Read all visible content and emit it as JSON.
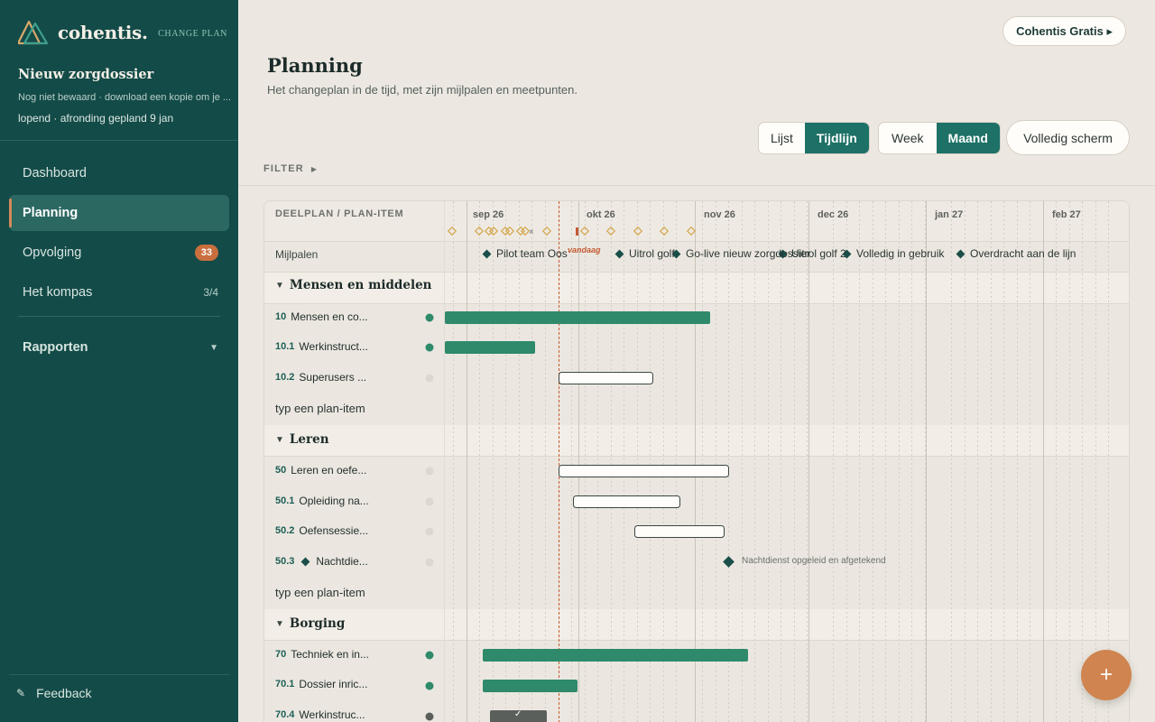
{
  "brand": {
    "name": "cohentis.",
    "tag": "CHANGE PLAN"
  },
  "dossier": {
    "title": "Nieuw zorgdossier",
    "note": "Nog niet bewaard · download een kopie om je ...",
    "status": "lopend · afronding gepland 9 jan"
  },
  "nav": {
    "dashboard": "Dashboard",
    "planning": "Planning",
    "opvolging": "Opvolging",
    "opvolging_badge": "33",
    "kompas": "Het kompas",
    "kompas_count": "3/4",
    "rapporten": "Rapporten"
  },
  "feedback": "Feedback",
  "header": {
    "plan_button": "Cohentis Gratis ▸",
    "title": "Planning",
    "subtitle": "Het changeplan in de tijd, met zijn mijlpalen en meetpunten."
  },
  "view_toggle": {
    "list": "Lijst",
    "timeline": "Tijdlijn"
  },
  "scale_toggle": {
    "week": "Week",
    "month": "Maand"
  },
  "fullscreen": "Volledig scherm",
  "filter": "FILTER",
  "timeline": {
    "column_header": "DEELPLAN / PLAN-ITEM",
    "months": [
      "sep 26",
      "okt 26",
      "nov 26",
      "dec 26",
      "jan 27",
      "feb 27"
    ],
    "today_label": "vandaag",
    "milestones_row_label": "Mijlpalen",
    "milestones": [
      "Pilot team Oos",
      "Uitrol golf",
      "Go-live nieuw zorgdossier",
      "Uitrol golf 2",
      "Volledig in gebruik",
      "Overdracht aan de lijn"
    ],
    "add_item": "typ een plan-item",
    "groups": [
      {
        "name": "Mensen en middelen",
        "items": [
          {
            "num": "10",
            "label": "Mensen en co...",
            "status": "active"
          },
          {
            "num": "10.1",
            "label": "Werkinstruct...",
            "status": "active"
          },
          {
            "num": "10.2",
            "label": "Superusers ...",
            "status": "planned"
          }
        ]
      },
      {
        "name": "Leren",
        "items": [
          {
            "num": "50",
            "label": "Leren en oefe...",
            "status": "planned"
          },
          {
            "num": "50.1",
            "label": "Opleiding na...",
            "status": "planned"
          },
          {
            "num": "50.2",
            "label": "Oefensessie...",
            "status": "planned"
          },
          {
            "num": "50.3",
            "label": "Nachtdie...",
            "status": "planned",
            "milestone": "Nachtdienst opgeleid en afgetekend"
          }
        ]
      },
      {
        "name": "Borging",
        "items": [
          {
            "num": "70",
            "label": "Techniek en in...",
            "status": "active"
          },
          {
            "num": "70.1",
            "label": "Dossier inric...",
            "status": "active"
          },
          {
            "num": "70.4",
            "label": "Werkinstruc...",
            "status": "done",
            "check": "✓"
          }
        ]
      }
    ]
  },
  "fab": "+",
  "colors": {
    "sidebar": "#134b48",
    "accent": "#1d7166",
    "bar": "#2e8a6b",
    "badge": "#c96f3d",
    "today": "#c45a32",
    "fab": "#d0844f"
  }
}
